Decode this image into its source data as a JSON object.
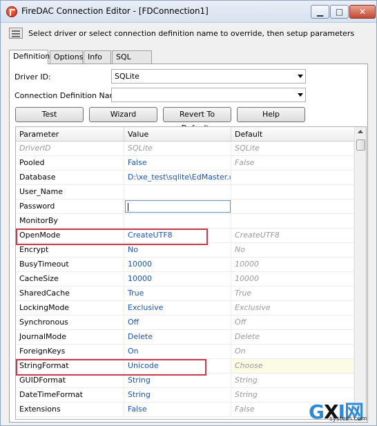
{
  "window": {
    "title": "FireDAC Connection Editor - [FDConnection1]",
    "controls": {
      "minimize": "▁",
      "maximize": "□",
      "close": "✕"
    }
  },
  "hint": "Select driver or select connection definition name to override, then setup parameters",
  "tabs": [
    {
      "label": "Definition",
      "active": true
    },
    {
      "label": "Options"
    },
    {
      "label": "Info"
    },
    {
      "label": "SQL Script"
    }
  ],
  "form": {
    "driver_label": "Driver ID:",
    "driver_value": "SQLite",
    "conndef_label": "Connection Definition Name:",
    "conndef_value": ""
  },
  "buttons": {
    "test": "Test",
    "wizard": "Wizard",
    "revert": "Revert To Defaults",
    "help": "Help"
  },
  "grid": {
    "headers": {
      "parameter": "Parameter",
      "value": "Value",
      "default": "Default"
    },
    "rows": [
      {
        "param": "DriverID",
        "value": "SQLite",
        "default": "SQLite"
      },
      {
        "param": "Pooled",
        "value": "False",
        "default": "False"
      },
      {
        "param": "Database",
        "value": "D:\\xe_test\\sqlite\\EdMaster.db",
        "default": ""
      },
      {
        "param": "User_Name",
        "value": "",
        "default": ""
      },
      {
        "param": "Password",
        "value": "",
        "default": ""
      },
      {
        "param": "MonitorBy",
        "value": "",
        "default": ""
      },
      {
        "param": "OpenMode",
        "value": "CreateUTF8",
        "default": "CreateUTF8"
      },
      {
        "param": "Encrypt",
        "value": "No",
        "default": "No"
      },
      {
        "param": "BusyTimeout",
        "value": "10000",
        "default": "10000"
      },
      {
        "param": "CacheSize",
        "value": "10000",
        "default": "10000"
      },
      {
        "param": "SharedCache",
        "value": "True",
        "default": "True"
      },
      {
        "param": "LockingMode",
        "value": "Exclusive",
        "default": "Exclusive"
      },
      {
        "param": "Synchronous",
        "value": "Off",
        "default": "Off"
      },
      {
        "param": "JournalMode",
        "value": "Delete",
        "default": "Delete"
      },
      {
        "param": "ForeignKeys",
        "value": "On",
        "default": "On"
      },
      {
        "param": "StringFormat",
        "value": "Unicode",
        "default": "Choose"
      },
      {
        "param": "GUIDFormat",
        "value": "String",
        "default": "String"
      },
      {
        "param": "DateTimeFormat",
        "value": "String",
        "default": "String"
      },
      {
        "param": "Extensions",
        "value": "False",
        "default": "False"
      }
    ]
  },
  "watermark": {
    "main_g": "G",
    "main_x": "X",
    "main_rest": "I网",
    "sub": "system.com"
  },
  "colors": {
    "value_text": "#1a54a8",
    "default_text": "#9a9a9a",
    "highlight_border": "#c8394b"
  }
}
